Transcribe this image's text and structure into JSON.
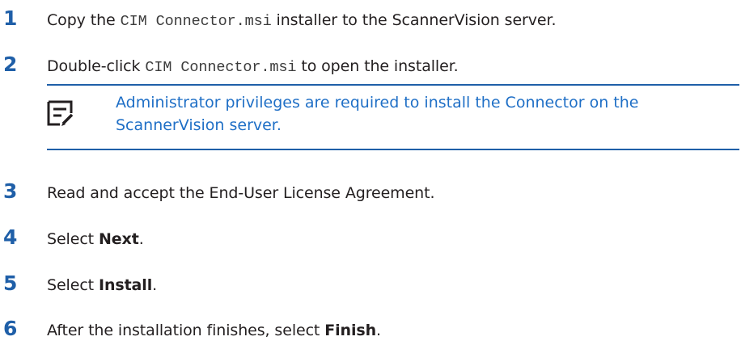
{
  "steps": [
    {
      "number": "1",
      "pre": "Copy the ",
      "code": "CIM Connector.msi",
      "post": " installer to the ScannerVision server."
    },
    {
      "number": "2",
      "pre": "Double-click ",
      "code": "CIM Connector.msi",
      "post": " to open the installer."
    },
    {
      "number": "3",
      "text": "Read and accept the End-User License Agreement."
    },
    {
      "number": "4",
      "pre": "Select ",
      "bold": "Next",
      "post": "."
    },
    {
      "number": "5",
      "pre": "Select ",
      "bold": "Install",
      "post": "."
    },
    {
      "number": "6",
      "pre": "After the installation finishes, select ",
      "bold": "Finish",
      "post": "."
    }
  ],
  "note": {
    "icon": "note-icon",
    "text": "Administrator privileges are required to install the Connector on the ScannerVision server."
  },
  "colors": {
    "step_number": "#1f5fa8",
    "note_text": "#1f6fc6",
    "rule": "#1f5fa8",
    "body_text": "#231f20"
  }
}
